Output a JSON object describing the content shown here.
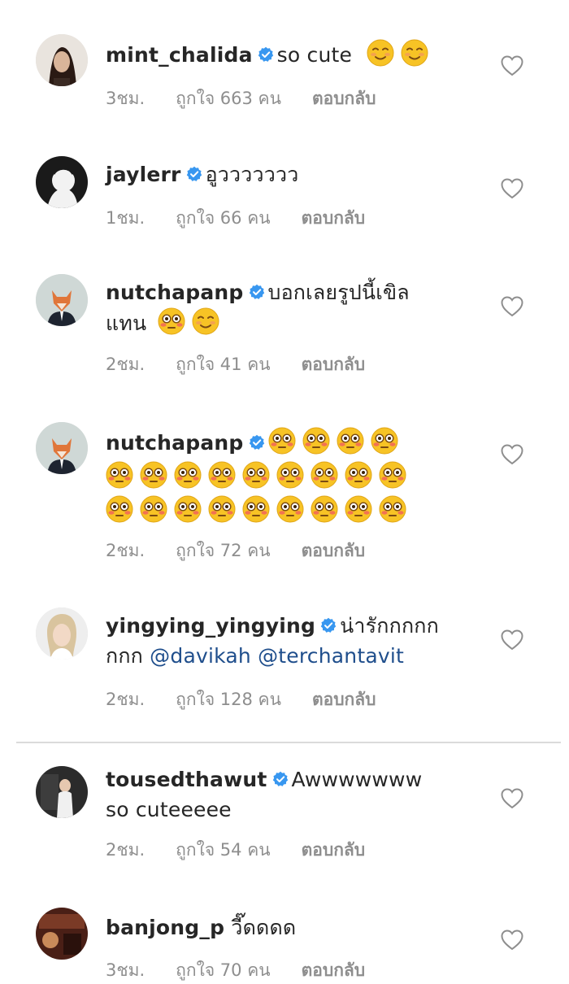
{
  "comments": [
    {
      "username": "mint_chalida",
      "text": "so cute",
      "time": "3ชม.",
      "likes": "ถูกใจ 663 คน",
      "reply": "ตอบกลับ"
    },
    {
      "username": "jaylerr",
      "text": "อูววววววว",
      "time": "1ชม.",
      "likes": "ถูกใจ 66 คน",
      "reply": "ตอบกลับ"
    },
    {
      "username": "nutchapanp",
      "text": "บอกเลยรูปนี้เขิล",
      "text2": "แทน",
      "time": "2ชม.",
      "likes": "ถูกใจ 41 คน",
      "reply": "ตอบกลับ"
    },
    {
      "username": "nutchapanp",
      "text": "",
      "time": "2ชม.",
      "likes": "ถูกใจ 72 คน",
      "reply": "ตอบกลับ"
    },
    {
      "username": "yingying_yingying",
      "text": "น่ารักกกกก",
      "text2": "กกก",
      "mention1": "@davikah",
      "mention2": "@terchantavit",
      "time": "2ชม.",
      "likes": "ถูกใจ 128 คน",
      "reply": "ตอบกลับ"
    },
    {
      "username": "tousedthawut",
      "text": "Awwwwwww",
      "text2": "so cuteeeee",
      "time": "2ชม.",
      "likes": "ถูกใจ 54 คน",
      "reply": "ตอบกลับ"
    },
    {
      "username": "banjong_p",
      "text": "วี๊ดดดด",
      "time": "3ชม.",
      "likes": "ถูกใจ 70 คน",
      "reply": "ตอบกลับ"
    }
  ],
  "icons": {
    "verified": "verified-badge-icon",
    "heart": "heart-outline-icon",
    "emoji_smile": "smiling-face-icon",
    "emoji_flushed": "flushed-face-icon"
  },
  "colors": {
    "verified_blue": "#3897f0",
    "meta_gray": "#8e8e8e",
    "mention_blue": "#1f4e8c"
  }
}
